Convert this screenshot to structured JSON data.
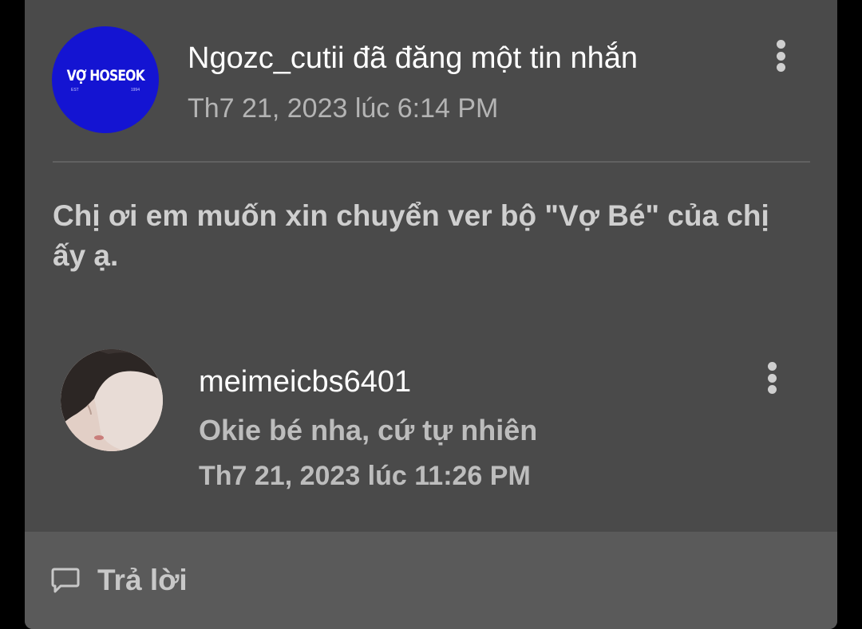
{
  "post": {
    "avatar_logo": {
      "text": "VỢ HOSEOK",
      "left_small": "EST",
      "right_small": "1994",
      "bg_color": "#1414d2"
    },
    "title": "Ngozc_cutii đã đăng một tin nhắn",
    "timestamp": "Th7 21, 2023 lúc 6:14 PM",
    "body": "Chị ơi em muốn xin chuyển ver bộ \"Vợ Bé\" của chị ấy ạ."
  },
  "reply": {
    "username": "meimeicbs6401",
    "text": "Okie bé nha, cứ tự nhiên",
    "timestamp": "Th7 21, 2023 lúc 11:26 PM"
  },
  "actions": {
    "reply_label": "Trả lời",
    "reply_icon": "chat-bubble-icon",
    "more_icon": "more-vertical-icon"
  }
}
